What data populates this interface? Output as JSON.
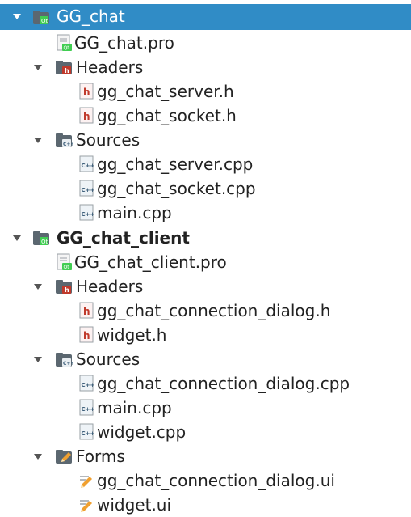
{
  "colors": {
    "selection": "#308cc6",
    "folder": "#5b6770",
    "qt_green": "#41cd52",
    "header_red": "#c0392b"
  },
  "projects": [
    {
      "name": "GG_chat",
      "selected": true,
      "pro_file": "GG_chat.pro",
      "headers_label": "Headers",
      "headers": [
        "gg_chat_server.h",
        "gg_chat_socket.h"
      ],
      "sources_label": "Sources",
      "sources": [
        "gg_chat_server.cpp",
        "gg_chat_socket.cpp",
        "main.cpp"
      ]
    },
    {
      "name": "GG_chat_client",
      "selected": false,
      "pro_file": "GG_chat_client.pro",
      "headers_label": "Headers",
      "headers": [
        "gg_chat_connection_dialog.h",
        "widget.h"
      ],
      "sources_label": "Sources",
      "sources": [
        "gg_chat_connection_dialog.cpp",
        "main.cpp",
        "widget.cpp"
      ],
      "forms_label": "Forms",
      "forms": [
        "gg_chat_connection_dialog.ui",
        "widget.ui"
      ]
    }
  ],
  "icons": {
    "project": "qt-project-folder-icon",
    "pro": "qt-pro-file-icon",
    "headers_folder": "headers-folder-icon",
    "header": "header-file-icon",
    "sources_folder": "sources-folder-icon",
    "cpp": "cpp-file-icon",
    "forms_folder": "forms-folder-icon",
    "ui": "ui-form-file-icon",
    "expand": "expanded-arrow-icon"
  }
}
